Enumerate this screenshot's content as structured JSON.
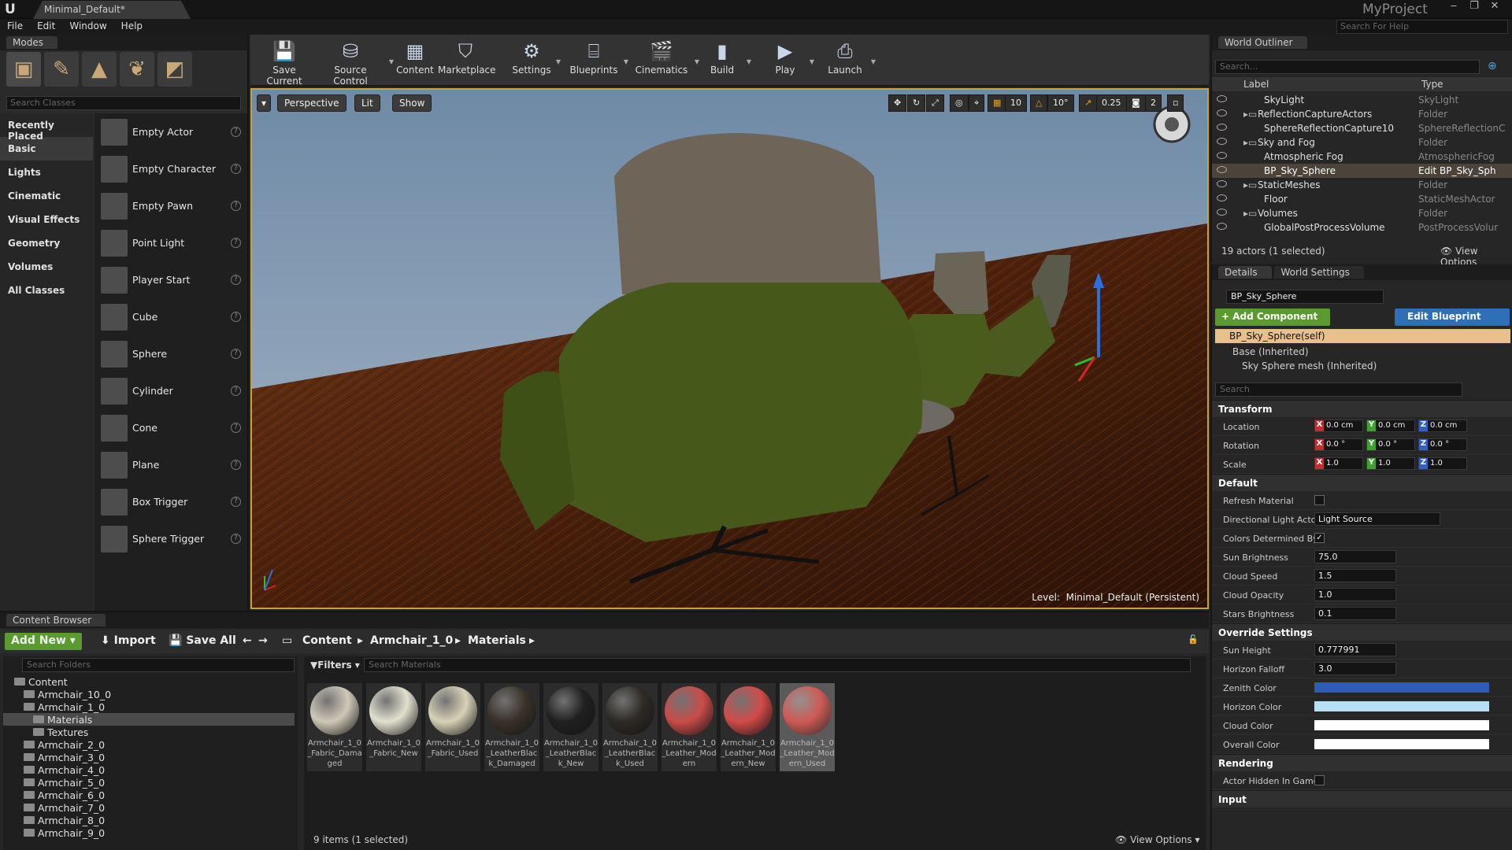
{
  "window": {
    "tab_title": "Minimal_Default*",
    "project": "MyProject",
    "help_search_placeholder": "Search For Help"
  },
  "menu": [
    "File",
    "Edit",
    "Window",
    "Help"
  ],
  "modes": {
    "tab": "Modes",
    "search_placeholder": "Search Classes",
    "categories": [
      "Recently Placed",
      "Basic",
      "Lights",
      "Cinematic",
      "Visual Effects",
      "Geometry",
      "Volumes",
      "All Classes"
    ],
    "items": [
      "Empty Actor",
      "Empty Character",
      "Empty Pawn",
      "Point Light",
      "Player Start",
      "Cube",
      "Sphere",
      "Cylinder",
      "Cone",
      "Plane",
      "Box Trigger",
      "Sphere Trigger"
    ]
  },
  "toolbar": {
    "buttons": [
      "Save Current",
      "Source Control",
      "Content",
      "Marketplace",
      "Settings",
      "Blueprints",
      "Cinematics",
      "Build",
      "Play",
      "Launch"
    ]
  },
  "viewport": {
    "perspective": "Perspective",
    "lit": "Lit",
    "show": "Show",
    "grid_snap": "10",
    "rot_snap": "10°",
    "scale_snap": "0.25",
    "cam_speed": "2",
    "level_label": "Level:",
    "level_name": "Minimal_Default (Persistent)"
  },
  "outliner": {
    "tab": "World Outliner",
    "search_placeholder": "Search...",
    "col_label": "Label",
    "col_type": "Type",
    "rows": [
      {
        "name": "SkyLight",
        "type": "SkyLight"
      },
      {
        "name": "ReflectionCaptureActors",
        "type": "Folder"
      },
      {
        "name": "SphereReflectionCapture10",
        "type": "SphereReflectionC"
      },
      {
        "name": "Sky and Fog",
        "type": "Folder"
      },
      {
        "name": "Atmospheric Fog",
        "type": "AtmosphericFog"
      },
      {
        "name": "BP_Sky_Sphere",
        "type": "Edit BP_Sky_Sph"
      },
      {
        "name": "StaticMeshes",
        "type": "Folder"
      },
      {
        "name": "Floor",
        "type": "StaticMeshActor"
      },
      {
        "name": "Volumes",
        "type": "Folder"
      },
      {
        "name": "GlobalPostProcessVolume",
        "type": "PostProcessVolur"
      }
    ],
    "footer": "19 actors (1 selected)",
    "view_options": "View Options"
  },
  "details": {
    "tab": "Details",
    "tab2": "World Settings",
    "actor_name": "BP_Sky_Sphere",
    "add_component": "+ Add Component",
    "edit_blueprint": "Edit Blueprint",
    "self": "BP_Sky_Sphere(self)",
    "base": "Base (Inherited)",
    "sky_mesh": "Sky Sphere mesh (Inherited)",
    "search_placeholder": "Search",
    "transform": "Transform",
    "location": "Location",
    "rotation": "Rotation",
    "scale": "Scale",
    "loc": [
      "0.0 cm",
      "0.0 cm",
      "0.0 cm"
    ],
    "rot": [
      "0.0 °",
      "0.0 °",
      "0.0 °"
    ],
    "scl": [
      "1.0",
      "1.0",
      "1.0"
    ],
    "default": "Default",
    "refresh_material": "Refresh Material",
    "dir_light_actor": "Directional Light Actor",
    "dir_light_value": "Light Source",
    "colors_determined": "Colors Determined By",
    "sun_brightness": "Sun Brightness",
    "sun_brightness_v": "75.0",
    "cloud_speed": "Cloud Speed",
    "cloud_speed_v": "1.5",
    "cloud_opacity": "Cloud Opacity",
    "cloud_opacity_v": "1.0",
    "stars_brightness": "Stars Brightness",
    "stars_brightness_v": "0.1",
    "override": "Override Settings",
    "sun_height": "Sun Height",
    "sun_height_v": "0.777991",
    "horizon_falloff": "Horizon Falloff",
    "horizon_falloff_v": "3.0",
    "zenith_color": "Zenith Color",
    "horizon_color": "Horizon Color",
    "cloud_color": "Cloud Color",
    "overall_color": "Overall Color",
    "rendering": "Rendering",
    "actor_hidden": "Actor Hidden In Game",
    "input": "Input",
    "colors": {
      "zenith": "#2b5db8",
      "horizon": "#b7e0f5",
      "cloud": "#ffffff",
      "overall": "#ffffff"
    }
  },
  "content_browser": {
    "tab": "Content Browser",
    "add_new": "Add New",
    "import": "Import",
    "save_all": "Save All",
    "breadcrumb": [
      "Content",
      "Armchair_1_0",
      "Materials"
    ],
    "search_folders": "Search Folders",
    "filters": "Filters",
    "search_materials": "Search Materials",
    "folders": [
      {
        "name": "Content",
        "level": 0
      },
      {
        "name": "Armchair_10_0",
        "level": 1
      },
      {
        "name": "Armchair_1_0",
        "level": 1
      },
      {
        "name": "Materials",
        "level": 2
      },
      {
        "name": "Textures",
        "level": 2
      },
      {
        "name": "Armchair_2_0",
        "level": 1
      },
      {
        "name": "Armchair_3_0",
        "level": 1
      },
      {
        "name": "Armchair_4_0",
        "level": 1
      },
      {
        "name": "Armchair_5_0",
        "level": 1
      },
      {
        "name": "Armchair_6_0",
        "level": 1
      },
      {
        "name": "Armchair_7_0",
        "level": 1
      },
      {
        "name": "Armchair_8_0",
        "level": 1
      },
      {
        "name": "Armchair_9_0",
        "level": 1
      }
    ],
    "assets": [
      {
        "name": "Armchair_1_0_Fabric_Damaged",
        "color": "#cfc8b8"
      },
      {
        "name": "Armchair_1_0_Fabric_New",
        "color": "#e3e0cf"
      },
      {
        "name": "Armchair_1_0_Fabric_Used",
        "color": "#d7d1b6"
      },
      {
        "name": "Armchair_1_0_LeatherBlack_Damaged",
        "color": "#3a3128"
      },
      {
        "name": "Armchair_1_0_LeatherBlack_New",
        "color": "#202020"
      },
      {
        "name": "Armchair_1_0_LeatherBlack_Used",
        "color": "#2e2a24"
      },
      {
        "name": "Armchair_1_0_Leather_Modern",
        "color": "#c94c48"
      },
      {
        "name": "Armchair_1_0_Leather_Modern_New",
        "color": "#d24b48"
      },
      {
        "name": "Armchair_1_0_Leather_Modern_Used",
        "color": "#cf5a54"
      }
    ],
    "footer": "9 items (1 selected)",
    "view_options": "View Options"
  }
}
